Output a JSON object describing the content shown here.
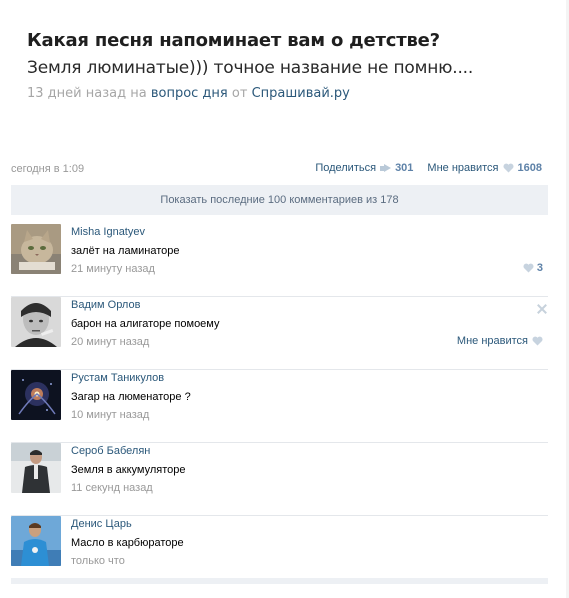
{
  "question": {
    "title": "Какая песня напоминает вам о детстве?",
    "answer": "Земля люминатые))) точное название не помню....",
    "meta_time": "13 дней назад",
    "meta_on": "на",
    "meta_topic": "вопрос дня",
    "meta_from": "от",
    "meta_source": "Спрашивай.ру"
  },
  "post": {
    "date": "сегодня в 1:09",
    "share_label": "Поделиться",
    "share_count": "301",
    "like_label": "Мне нравится",
    "like_count": "1608"
  },
  "show_all": "Показать последние 100 комментариев из 178",
  "comments": [
    {
      "name": "Misha Ignatyev",
      "text": "залёт на ламинаторе",
      "time": "21 минуту назад",
      "likes": "3"
    },
    {
      "name": "Вадим Орлов",
      "text": "барон на алигаторе помоему",
      "time": "20 минут назад",
      "like_label": "Мне нравится"
    },
    {
      "name": "Рустам Таникулов",
      "text": "Загар на люменаторе ?",
      "time": "10 минут назад"
    },
    {
      "name": "Сероб Бабелян",
      "text": "Земля в аккумуляторе",
      "time": "11 секунд назад"
    },
    {
      "name": "Денис Царь",
      "text": "Масло в карбюраторе",
      "time": "только что"
    }
  ],
  "icons": {
    "share": "megaphone-icon",
    "like": "heart-icon",
    "delete": "close-icon"
  },
  "colors": {
    "link": "#2b587a",
    "muted": "#999999",
    "panel": "#edf0f4"
  }
}
